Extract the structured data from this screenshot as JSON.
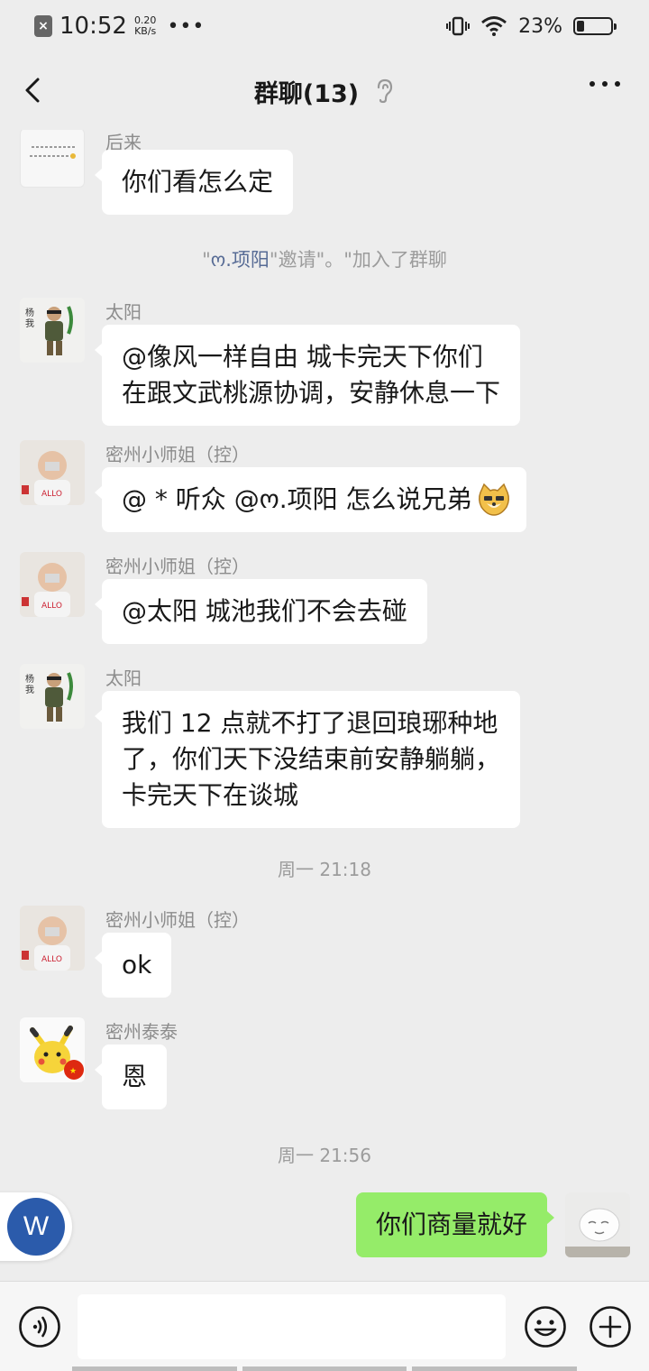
{
  "status_bar": {
    "time": "10:52",
    "speed_value": "0.20",
    "speed_unit": "KB/s",
    "dots": "•••",
    "battery": "23%",
    "battery_level": 0.23
  },
  "header": {
    "title": "群聊(13)"
  },
  "messages": {
    "m1": {
      "sender": "后来",
      "text": "你们看怎么定"
    },
    "sys": {
      "q1": "\"",
      "name": "ო.项阳",
      "mid": "\"邀请\"",
      "rest": "。\"加入了群聊"
    },
    "m2": {
      "sender": "太阳",
      "line1": "@像风一样自由  城卡完天下你们",
      "line2": "在跟文武桃源协调，安静休息一下"
    },
    "m3": {
      "sender": "密州小师姐（控）",
      "text": "@ * 听众 @ო.项阳 怎么说兄弟"
    },
    "m4": {
      "sender": "密州小师姐（控）",
      "text": "@太阳  城池我们不会去碰"
    },
    "m5": {
      "sender": "太阳",
      "line1": "我们 12 点就不打了退回琅琊种地",
      "line2": "了，你们天下没结束前安静躺躺，",
      "line3": "卡完天下在谈城"
    },
    "t1": "周一 21:18",
    "m6": {
      "sender": "密州小师姐（控）",
      "text": "ok"
    },
    "m7": {
      "sender": "密州泰泰",
      "text": "恩"
    },
    "t2": "周一 21:56",
    "self": {
      "text": "你们商量就好"
    }
  },
  "float_button": {
    "label": "W"
  },
  "colors": {
    "background": "#ededed",
    "bubble_other": "#ffffff",
    "bubble_self": "#95ec69",
    "link": "#576b95",
    "float_circle": "#2b5bab"
  },
  "icons": {
    "back": "chevron-left-icon",
    "ear": "ear-icon",
    "more": "more-icon",
    "voice": "voice-icon",
    "emoji": "emoji-icon",
    "plus": "plus-icon",
    "doge": "doge-emoji-icon"
  }
}
